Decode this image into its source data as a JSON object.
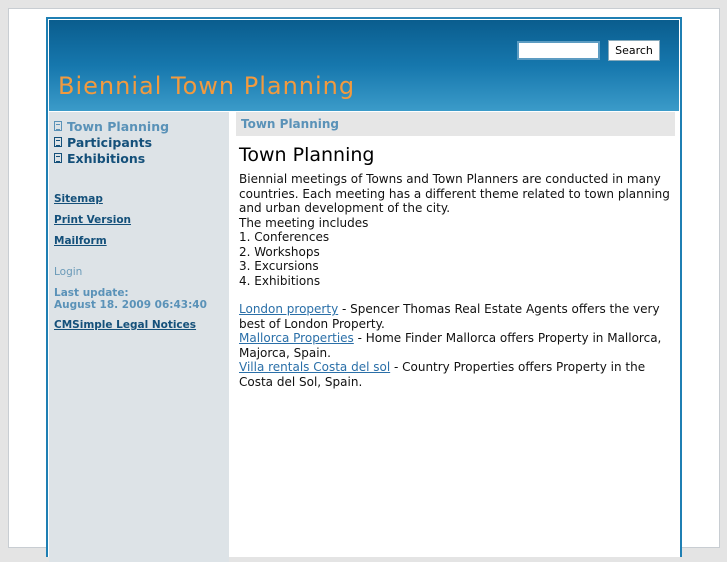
{
  "header": {
    "title": "Biennial Town Planning",
    "search_placeholder": "",
    "search_label": "Search"
  },
  "sidebar": {
    "nav": [
      {
        "label": "Town Planning"
      },
      {
        "label": "Participants"
      },
      {
        "label": "Exhibitions"
      }
    ],
    "links": {
      "sitemap": "Sitemap",
      "print": "Print Version",
      "mailform": "Mailform"
    },
    "login": "Login",
    "last_update_label": "Last update:",
    "last_update_value": "August 18. 2009 06:43:40",
    "legal": "CMSimple Legal Notices"
  },
  "main": {
    "breadcrumb": "Town Planning",
    "heading": "Town Planning",
    "intro": "Biennial meetings of Towns and Town Planners are conducted in many countries. Each meeting has a different theme related to town planning and urban development of the city.",
    "includes": "The meeting includes",
    "list": [
      "1. Conferences",
      "2. Workshops",
      "3. Excursions",
      "4. Exhibitions"
    ],
    "ads": [
      {
        "link": "London property",
        "text": " - Spencer Thomas Real Estate Agents offers the very best of London Property."
      },
      {
        "link": "Mallorca Properties",
        "text": " - Home Finder Mallorca offers Property in Mallorca, Majorca, Spain."
      },
      {
        "link": "Villa rentals Costa del sol",
        "text": " -  Country Properties offers Property in the Costa del Sol, Spain."
      }
    ]
  }
}
